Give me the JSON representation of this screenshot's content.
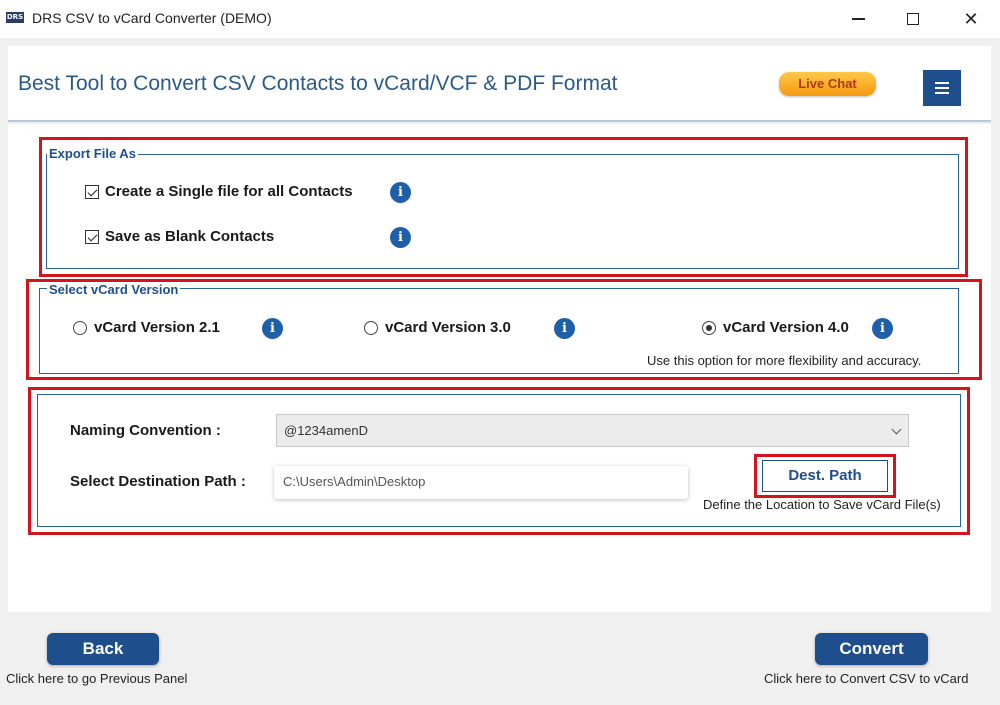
{
  "window": {
    "logo_text": "DRS",
    "title": "DRS CSV to vCard Converter (DEMO)",
    "close_glyph": "✕"
  },
  "header": {
    "tagline": "Best Tool to Convert CSV Contacts to vCard/VCF & PDF Format",
    "live_chat_label": "Live Chat",
    "menu_icon": "hamburger-menu-icon"
  },
  "export": {
    "legend": "Export File As",
    "options": [
      {
        "label": "Create a Single file for all Contacts",
        "checked": true
      },
      {
        "label": "Save as Blank Contacts",
        "checked": true
      }
    ],
    "info_glyph": "i"
  },
  "vcard": {
    "legend": "Select vCard Version",
    "versions": [
      {
        "label": "vCard Version 2.1",
        "selected": false
      },
      {
        "label": "vCard Version 3.0",
        "selected": false
      },
      {
        "label": "vCard Version 4.0",
        "selected": true
      }
    ],
    "hint": "Use this option for more flexibility and accuracy."
  },
  "destination": {
    "naming_label": "Naming Convention :",
    "naming_value": "@1234amenD",
    "path_label": "Select Destination Path :",
    "path_value": "C:\\Users\\Admin\\Desktop",
    "dest_button_label": "Dest. Path",
    "dest_hint": "Define the Location to Save vCard File(s)"
  },
  "footer": {
    "back_label": "Back",
    "back_hint": "Click here to go Previous Panel",
    "convert_label": "Convert",
    "convert_hint": "Click here to Convert CSV to vCard"
  },
  "colors": {
    "accent_blue": "#1e4f8c",
    "highlight_red": "#d4141c",
    "live_chat_orange": "#f59a0f"
  }
}
